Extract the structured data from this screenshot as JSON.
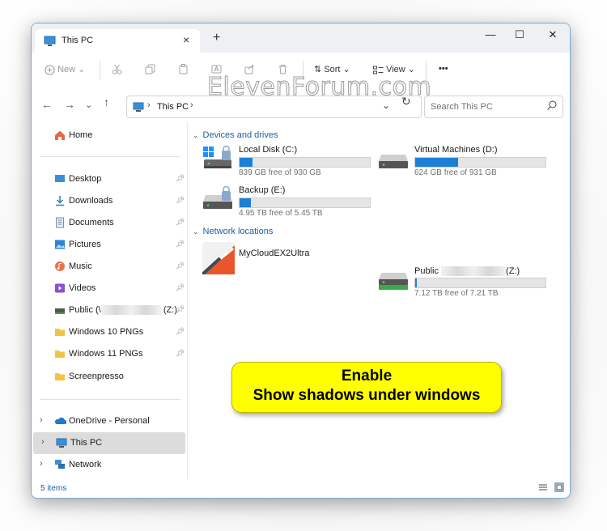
{
  "window": {
    "tab_title": "This PC",
    "new_tab": "+",
    "minimize": "—",
    "maximize": "☐",
    "close": "✕"
  },
  "watermark": "ElevenForum.com",
  "toolbar": {
    "new_label": "New",
    "sort_label": "Sort",
    "view_label": "View",
    "more": "•••"
  },
  "address": {
    "crumb": "This PC"
  },
  "search": {
    "placeholder": "Search This PC"
  },
  "sidebar": {
    "home": "Home",
    "quick": [
      {
        "label": "Desktop"
      },
      {
        "label": "Downloads"
      },
      {
        "label": "Documents"
      },
      {
        "label": "Pictures"
      },
      {
        "label": "Music"
      },
      {
        "label": "Videos"
      },
      {
        "label": "Public (\\",
        "suffix": "(Z:)"
      },
      {
        "label": "Windows 10 PNGs"
      },
      {
        "label": "Windows 11 PNGs"
      },
      {
        "label": "Screenpresso"
      }
    ],
    "onedrive": "OneDrive - Personal",
    "thispc": "This PC",
    "network": "Network"
  },
  "content": {
    "devices_header": "Devices and drives",
    "network_header": "Network locations",
    "drives": [
      {
        "name": "Local Disk (C:)",
        "free": "839 GB free of 930 GB",
        "used_fraction": 0.1
      },
      {
        "name": "Virtual Machines (D:)",
        "free": "624 GB free of 931 GB",
        "used_fraction": 0.33
      },
      {
        "name": "Backup (E:)",
        "free": "4.95 TB free of 5.45 TB",
        "used_fraction": 0.09
      }
    ],
    "network": [
      {
        "name": "MyCloudEX2Ultra"
      },
      {
        "name": "Public",
        "suffix": "(Z:)",
        "free": "7.12 TB free of 7.21 TB",
        "used_fraction": 0.012
      }
    ]
  },
  "status": {
    "count": "5 items"
  },
  "callout": {
    "line1": "Enable",
    "line2": "Show shadows under windows"
  },
  "colors": {
    "accent": "#1e7fd6",
    "callout_bg": "#ffff00",
    "selection": "#dcdcdc"
  }
}
